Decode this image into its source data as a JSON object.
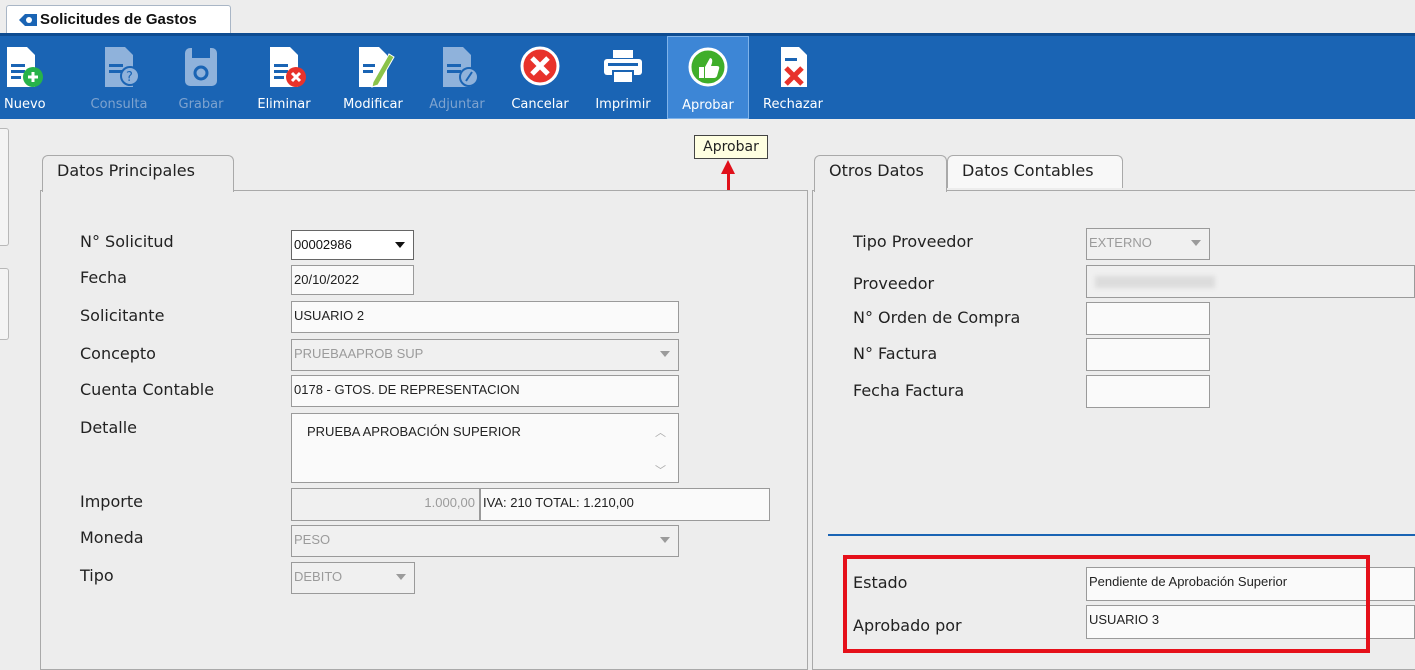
{
  "window_tab": {
    "title": "Solicitudes de Gastos"
  },
  "toolbar": {
    "buttons": [
      {
        "label": "Nuevo",
        "icon": "new-document-icon"
      },
      {
        "label": "Consulta",
        "icon": "query-document-icon"
      },
      {
        "label": "Grabar",
        "icon": "save-disk-icon"
      },
      {
        "label": "Eliminar",
        "icon": "delete-document-icon"
      },
      {
        "label": "Modificar",
        "icon": "edit-document-icon"
      },
      {
        "label": "Adjuntar",
        "icon": "attach-document-icon"
      },
      {
        "label": "Cancelar",
        "icon": "cancel-icon"
      },
      {
        "label": "Imprimir",
        "icon": "printer-icon"
      },
      {
        "label": "Aprobar",
        "icon": "thumbs-up-icon"
      },
      {
        "label": "Rechazar",
        "icon": "reject-document-icon"
      }
    ]
  },
  "tooltip": {
    "text": "Aprobar"
  },
  "left_panel": {
    "tab_label": "Datos Principales",
    "labels": {
      "solicitud": "N° Solicitud",
      "fecha": "Fecha",
      "solicitante": "Solicitante",
      "concepto": "Concepto",
      "cuenta": "Cuenta Contable",
      "detalle": "Detalle",
      "importe": "Importe",
      "moneda": "Moneda",
      "tipo": "Tipo"
    },
    "values": {
      "solicitud": "00002986",
      "fecha": "20/10/2022",
      "solicitante": "USUARIO 2",
      "concepto": "PRUEBAAPROB SUP",
      "cuenta": "0178 - GTOS. DE REPRESENTACION",
      "detalle": "PRUEBA APROBACIÓN SUPERIOR",
      "importe": "1.000,00",
      "importe_total": "IVA: 210 TOTAL:  1.210,00",
      "moneda": "PESO",
      "tipo": "DEBITO"
    }
  },
  "right_panel": {
    "tabs": [
      "Otros Datos",
      "Datos Contables"
    ],
    "labels": {
      "tipo_proveedor": "Tipo Proveedor",
      "proveedor": "Proveedor",
      "orden_compra": "N° Orden de Compra",
      "factura": "N° Factura",
      "fecha_factura": "Fecha Factura",
      "estado": "Estado",
      "aprobado_por": "Aprobado por"
    },
    "values": {
      "tipo_proveedor": "EXTERNO",
      "proveedor": "",
      "orden_compra": "",
      "factura": "",
      "fecha_factura": "",
      "estado": "Pendiente de Aprobación Superior",
      "aprobado_por": "USUARIO 3"
    }
  },
  "colors": {
    "toolbar": "#1a64b4",
    "highlight_box": "#e5101a",
    "tooltip_bg": "#ffffe1"
  }
}
